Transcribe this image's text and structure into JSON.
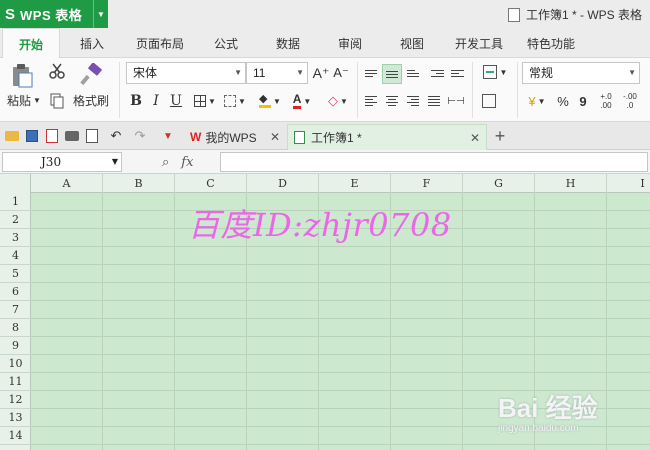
{
  "app": {
    "logo": "S",
    "name": "WPS 表格",
    "window_title": "工作簿1 * - WPS 表格"
  },
  "ribbon_tabs": [
    "开始",
    "插入",
    "页面布局",
    "公式",
    "数据",
    "审阅",
    "视图",
    "开发工具",
    "特色功能"
  ],
  "ribbon": {
    "paste_label": "粘贴",
    "format_painter_label": "格式刷",
    "font_name": "宋体",
    "font_size": "11",
    "number_format": "常规",
    "bold": "B",
    "italic": "I",
    "underline": "U",
    "grow_font": "A⁺",
    "shrink_font": "A⁻",
    "percent": "%",
    "comma": "9",
    "inc_decimal": "+.0 .00",
    "dec_decimal": "-.00 .0"
  },
  "doc_tabs": [
    {
      "label": "我的WPS",
      "active": false
    },
    {
      "label": "工作簿1 *",
      "active": true
    }
  ],
  "formula_bar": {
    "cell_ref": "J30",
    "fx": "fx"
  },
  "sheet": {
    "columns": [
      "A",
      "B",
      "C",
      "D",
      "E",
      "F",
      "G",
      "H",
      "I"
    ],
    "rows": [
      "1",
      "2",
      "3",
      "4",
      "5",
      "6",
      "7",
      "8",
      "9",
      "10",
      "11",
      "12",
      "13",
      "14"
    ]
  },
  "watermark": "百度ID:zhjr0708",
  "brand_mark": {
    "logo": "Bai 经验",
    "url": "jingyan.baidu.com"
  },
  "colors": {
    "accent": "#1f9b45",
    "sheet_bg": "#cce8cf",
    "watermark": "#ec67e8"
  }
}
